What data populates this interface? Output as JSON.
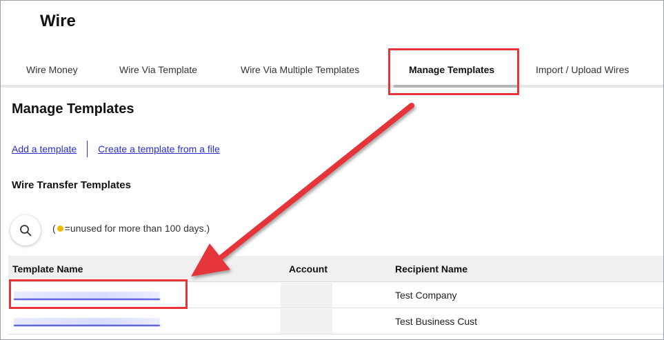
{
  "app": {
    "title": "Wire"
  },
  "tabs": [
    {
      "label": "Wire Money",
      "active": false
    },
    {
      "label": "Wire Via Template",
      "active": false
    },
    {
      "label": "Wire Via Multiple Templates",
      "active": false
    },
    {
      "label": "Manage Templates",
      "active": true
    },
    {
      "label": "Import / Upload Wires",
      "active": false
    }
  ],
  "page": {
    "heading": "Manage Templates",
    "links": {
      "add": "Add a template",
      "create_from_file": "Create a template from a file"
    },
    "section_heading": "Wire Transfer Templates",
    "legend": {
      "prefix": "(",
      "suffix": "=unused for more than 100 days.)"
    }
  },
  "table": {
    "headers": {
      "template_name": "Template Name",
      "account": "Account",
      "recipient": "Recipient Name"
    },
    "rows": [
      {
        "recipient": "Test Company"
      },
      {
        "recipient": "Test Business Cust"
      }
    ]
  },
  "colors": {
    "annotation": "#e5353b",
    "link": "#2b2fd1",
    "unused_dot": "#f2b705"
  },
  "icons": {
    "search": "search-icon"
  }
}
